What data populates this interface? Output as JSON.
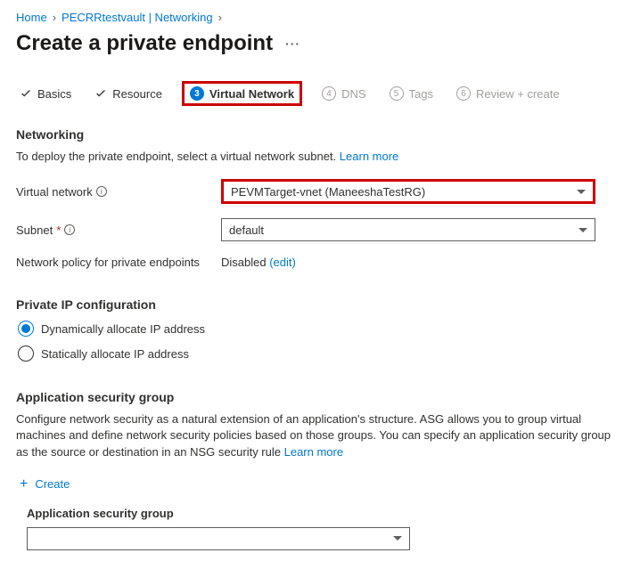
{
  "breadcrumb": {
    "home": "Home",
    "item": "PECRRtestvault | Networking"
  },
  "page_title": "Create a private endpoint",
  "tabs": {
    "basics": "Basics",
    "resource": "Resource",
    "vnet": "Virtual Network",
    "dns_num": "4",
    "dns": "DNS",
    "tags_num": "5",
    "tags": "Tags",
    "review_num": "6",
    "review": "Review + create",
    "active_num": "3"
  },
  "networking": {
    "heading": "Networking",
    "desc": "To deploy the private endpoint, select a virtual network subnet.",
    "learn_more": "Learn more"
  },
  "form": {
    "vnet_label": "Virtual network",
    "vnet_value": "PEVMTarget-vnet (ManeeshaTestRG)",
    "subnet_label": "Subnet",
    "subnet_value": "default",
    "policy_label": "Network policy for private endpoints",
    "policy_value": "Disabled",
    "policy_edit": "(edit)"
  },
  "ipconfig": {
    "heading": "Private IP configuration",
    "dynamic": "Dynamically allocate IP address",
    "static": "Statically allocate IP address"
  },
  "asg": {
    "heading": "Application security group",
    "desc": "Configure network security as a natural extension of an application's structure. ASG allows you to group virtual machines and define network security policies based on those groups. You can specify an application security group as the source or destination in an NSG security rule",
    "learn_more": "Learn more",
    "create": "Create",
    "label": "Application security group"
  }
}
